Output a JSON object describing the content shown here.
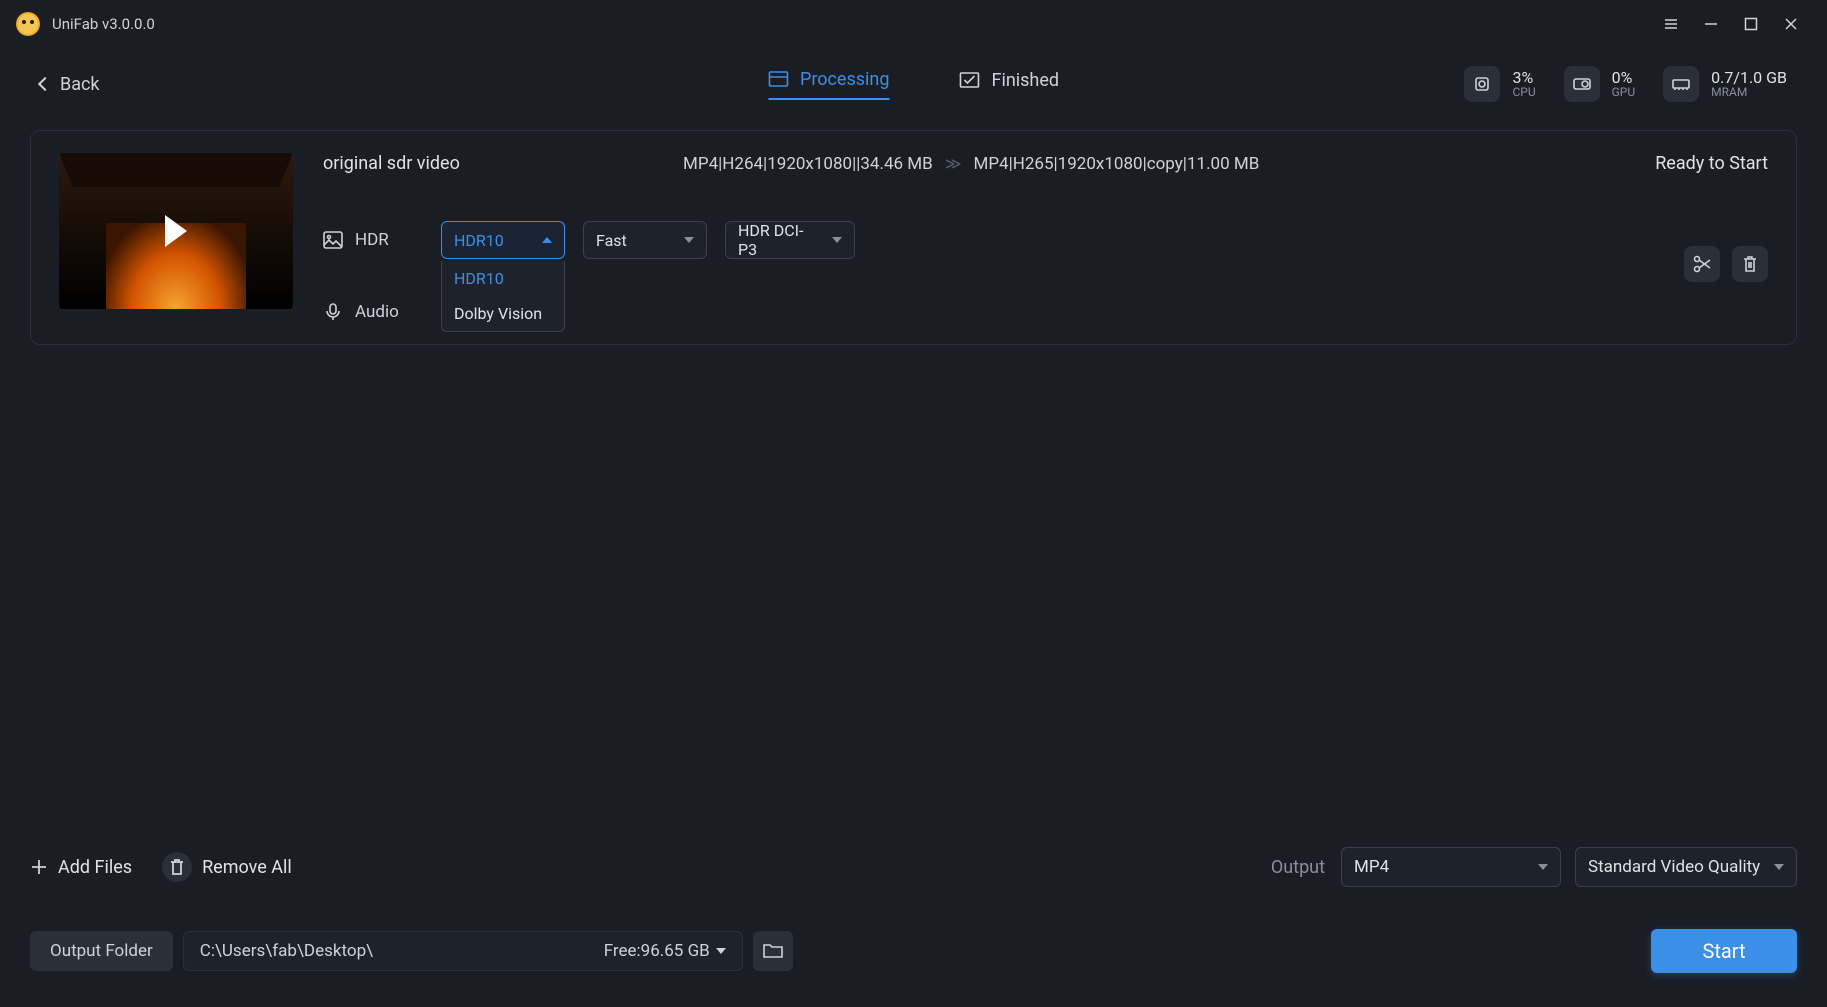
{
  "app": {
    "title": "UniFab v3.0.0.0"
  },
  "nav": {
    "back": "Back",
    "tabs": {
      "processing": "Processing",
      "finished": "Finished"
    }
  },
  "stats": {
    "cpu": {
      "value": "3%",
      "label": "CPU"
    },
    "gpu": {
      "value": "0%",
      "label": "GPU"
    },
    "mram": {
      "value": "0.7/1.0 GB",
      "label": "MRAM"
    }
  },
  "task": {
    "filename": "original sdr video",
    "source_spec": "MP4|H264|1920x1080||34.46 MB",
    "target_spec": "MP4|H265|1920x1080|copy|11.00 MB",
    "status": "Ready to Start",
    "hdr_label": "HDR",
    "hdr_format": {
      "selected": "HDR10",
      "options": [
        "HDR10",
        "Dolby Vision"
      ]
    },
    "speed": {
      "selected": "Fast"
    },
    "gamut": {
      "selected": "HDR DCI-P3"
    },
    "audio_label": "Audio"
  },
  "actions": {
    "add_files": "Add Files",
    "remove_all": "Remove All",
    "output_label": "Output",
    "output_format": "MP4",
    "output_quality": "Standard Video Quality"
  },
  "output": {
    "folder_button": "Output Folder",
    "path": "C:\\Users\\fab\\Desktop\\",
    "free": "Free:96.65 GB",
    "start": "Start"
  }
}
